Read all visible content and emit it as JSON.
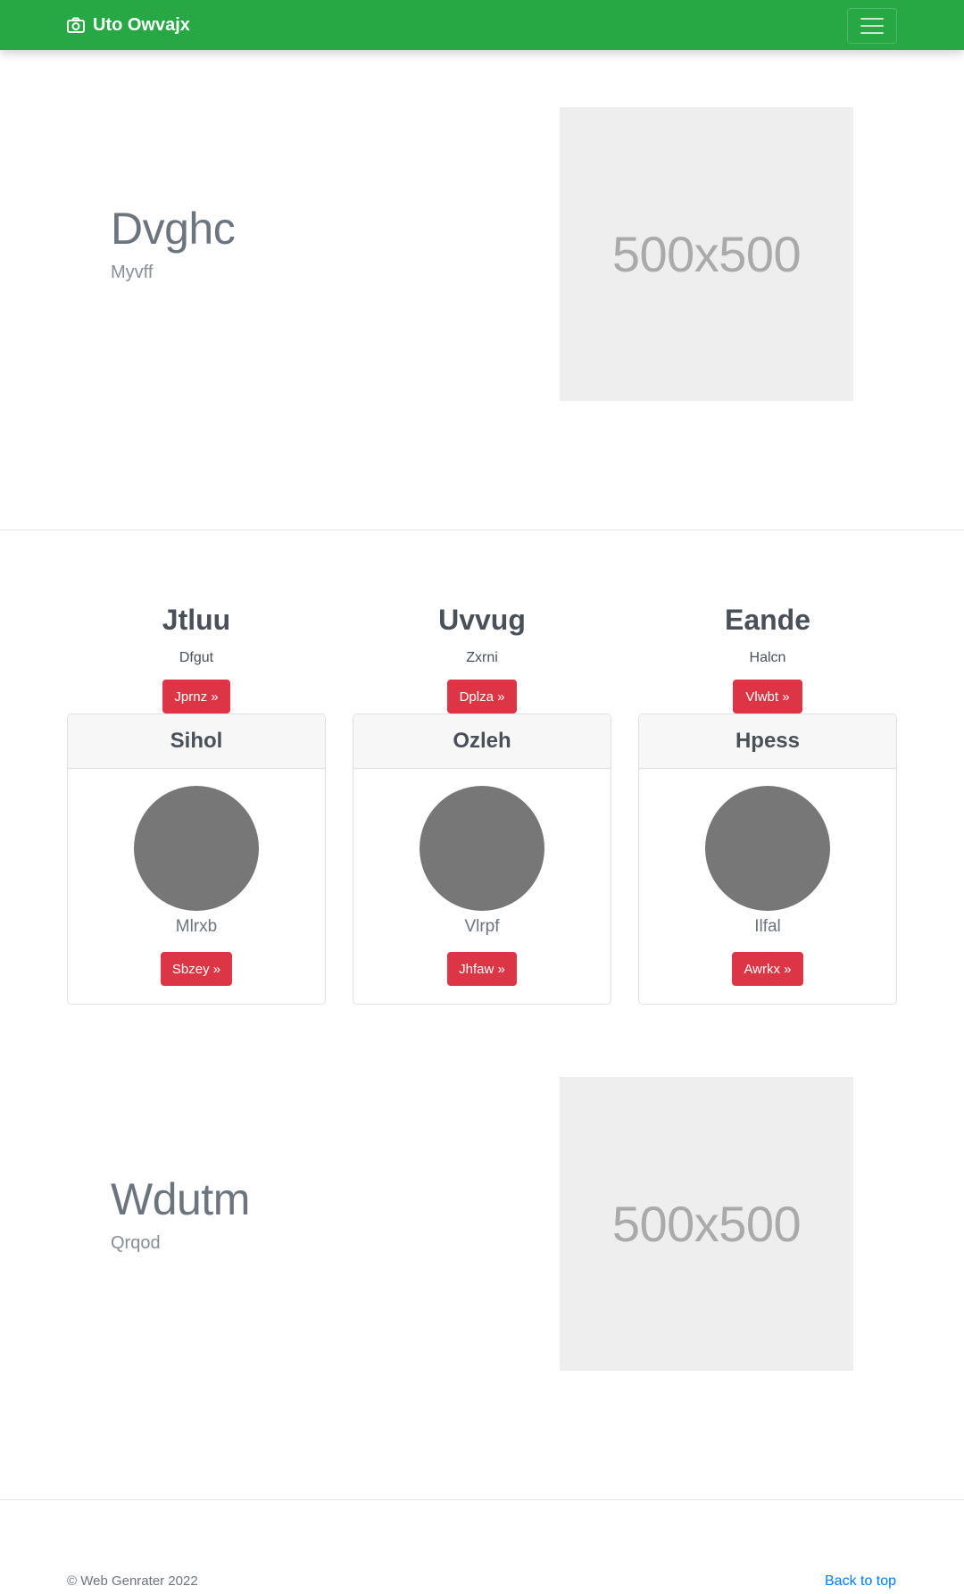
{
  "navbar": {
    "brand": "Uto Owvajx",
    "brand_icon": "camera-icon",
    "toggle_icon": "hamburger-icon"
  },
  "hero1": {
    "title": "Dvghc",
    "subtitle": "Myvff",
    "image_text": "500x500"
  },
  "columns": [
    {
      "title": "Jtluu",
      "text": "Dfgut",
      "button": "Jprnz »"
    },
    {
      "title": "Uvvug",
      "text": "Zxrni",
      "button": "Dplza »"
    },
    {
      "title": "Eande",
      "text": "Halcn",
      "button": "Vlwbt »"
    }
  ],
  "cards": [
    {
      "header": "Sihol",
      "name": "Mlrxb",
      "button": "Sbzey »"
    },
    {
      "header": "Ozleh",
      "name": "Vlrpf",
      "button": "Jhfaw »"
    },
    {
      "header": "Hpess",
      "name": "Ilfal",
      "button": "Awrkx »"
    }
  ],
  "hero2": {
    "title": "Wdutm",
    "subtitle": "Qrqod",
    "image_text": "500x500"
  },
  "footer": {
    "copyright": "© Web Genrater 2022",
    "back_to_top": "Back to top"
  },
  "colors": {
    "navbar": "#28a745",
    "button": "#dc3545",
    "link": "#007bff",
    "avatar": "#777777",
    "placeholder": "#eeeeee"
  }
}
